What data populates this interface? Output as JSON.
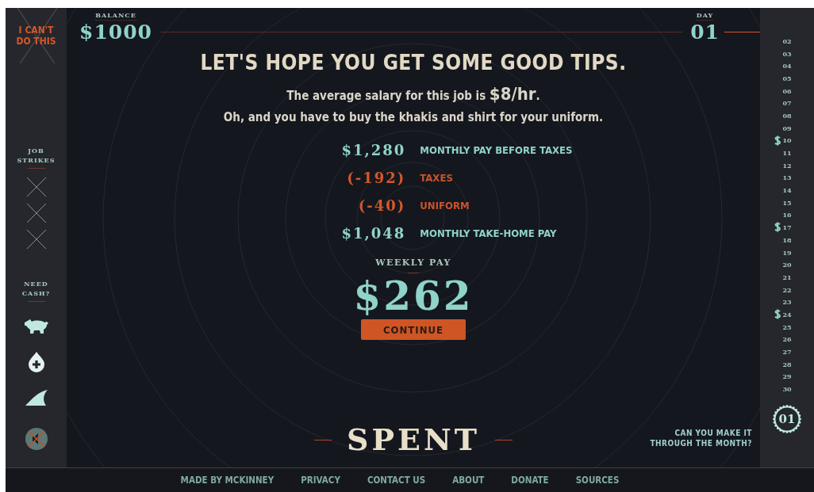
{
  "quit_button": {
    "label": "I CAN'T DO THIS"
  },
  "job_strikes": {
    "label": "JOB STRIKES",
    "strikes": [
      {
        "used": false
      },
      {
        "used": false
      },
      {
        "used": false
      }
    ]
  },
  "need_cash": {
    "label": "NEED CASH?",
    "options": [
      {
        "kind": "piggy"
      },
      {
        "kind": "drop"
      },
      {
        "kind": "fin"
      }
    ]
  },
  "sound": {
    "muted": true
  },
  "balance": {
    "label": "BALANCE",
    "value": "$1000"
  },
  "day": {
    "label": "DAY",
    "value": "01"
  },
  "headline": "LET'S HOPE YOU GET SOME GOOD TIPS.",
  "salary_line": "The average salary for this job is **$8/hr**.",
  "uniform_line": "Oh, and you have to buy the khakis and shirt for your uniform.",
  "breakdown": [
    {
      "kind": "income",
      "amount": "$1,280",
      "label": "MONTHLY PAY BEFORE TAXES"
    },
    {
      "kind": "deduction",
      "amount": "(-192)",
      "label": "TAXES"
    },
    {
      "kind": "deduction",
      "amount": "(-40)",
      "label": "UNIFORM"
    },
    {
      "kind": "income",
      "amount": "$1,048",
      "label": "MONTHLY TAKE-HOME PAY"
    }
  ],
  "weekly_pay": {
    "label": "WEEKLY PAY",
    "value": "$262"
  },
  "continue_button": "CONTINUE",
  "logo": "SPENT",
  "tagline": "CAN YOU MAKE IT THROUGH THE MONTH?",
  "calendar": [
    {
      "day": "02",
      "payday": false
    },
    {
      "day": "03",
      "payday": false
    },
    {
      "day": "04",
      "payday": false
    },
    {
      "day": "05",
      "payday": false
    },
    {
      "day": "06",
      "payday": false
    },
    {
      "day": "07",
      "payday": false
    },
    {
      "day": "08",
      "payday": false
    },
    {
      "day": "09",
      "payday": false
    },
    {
      "day": "10",
      "payday": true
    },
    {
      "day": "11",
      "payday": false
    },
    {
      "day": "12",
      "payday": false
    },
    {
      "day": "13",
      "payday": false
    },
    {
      "day": "14",
      "payday": false
    },
    {
      "day": "15",
      "payday": false
    },
    {
      "day": "16",
      "payday": false
    },
    {
      "day": "17",
      "payday": true
    },
    {
      "day": "18",
      "payday": false
    },
    {
      "day": "19",
      "payday": false
    },
    {
      "day": "20",
      "payday": false
    },
    {
      "day": "21",
      "payday": false
    },
    {
      "day": "22",
      "payday": false
    },
    {
      "day": "23",
      "payday": false
    },
    {
      "day": "24",
      "payday": true
    },
    {
      "day": "25",
      "payday": false
    },
    {
      "day": "26",
      "payday": false
    },
    {
      "day": "27",
      "payday": false
    },
    {
      "day": "28",
      "payday": false
    },
    {
      "day": "29",
      "payday": false
    },
    {
      "day": "30",
      "payday": false
    }
  ],
  "current_day_badge": "01",
  "footer_links": [
    "MADE BY MCKINNEY",
    "PRIVACY",
    "CONTACT US",
    "ABOUT",
    "DONATE",
    "SOURCES"
  ]
}
